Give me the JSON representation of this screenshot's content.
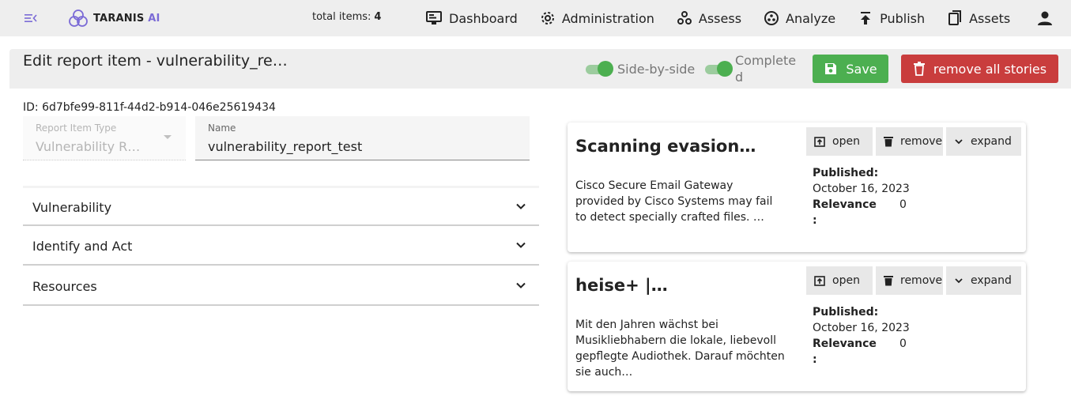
{
  "app": {
    "logo_main": "TARANIS",
    "logo_accent": "AI",
    "accent_color": "#7b6bd6"
  },
  "header": {
    "total_items_label": "total items:",
    "total_items_value": "4",
    "nav": [
      {
        "label": "Dashboard",
        "icon": "monitor-icon"
      },
      {
        "label": "Administration",
        "icon": "gear-icon"
      },
      {
        "label": "Assess",
        "icon": "share-nodes-icon"
      },
      {
        "label": "Analyze",
        "icon": "analyze-icon"
      },
      {
        "label": "Publish",
        "icon": "upload-icon"
      },
      {
        "label": "Assets",
        "icon": "documents-icon"
      }
    ],
    "user_icon": "user-icon"
  },
  "page": {
    "title": "Edit report item - vulnerability_re…",
    "side_by_side_label": "Side-by-side",
    "completed_label": "Completed",
    "save_label": "Save",
    "remove_all_label": "remove all stories",
    "save_color": "#4caf50",
    "remove_color": "#c93d3d"
  },
  "form": {
    "id_text": "ID: 6d7bfe99-811f-44d2-b914-046e25619434",
    "type_label": "Report Item Type",
    "type_value": "Vulnerability R…",
    "name_label": "Name",
    "name_value": "vulnerability_report_test",
    "panels": [
      "Vulnerability",
      "Identify and Act",
      "Resources"
    ]
  },
  "stories": [
    {
      "title": "Scanning evasion…",
      "summary": "Cisco Secure Email Gateway provided by Cisco Systems may fail to detect specially crafted files. …",
      "published_label": "Published:",
      "published_value": "October 16, 2023",
      "relevance_label": "Relevance",
      "relevance_colon": ":",
      "relevance_value": "0",
      "open_label": "open",
      "remove_label": "remove",
      "expand_label": "expand"
    },
    {
      "title": "heise+ |…",
      "summary": "Mit den Jahren wächst bei Musikliebhabern die lokale, liebevoll gepflegte Audiothek. Darauf möchten sie auch…",
      "published_label": "Published:",
      "published_value": "October 16, 2023",
      "relevance_label": "Relevance",
      "relevance_colon": ":",
      "relevance_value": "0",
      "open_label": "open",
      "remove_label": "remove",
      "expand_label": "expand"
    }
  ]
}
